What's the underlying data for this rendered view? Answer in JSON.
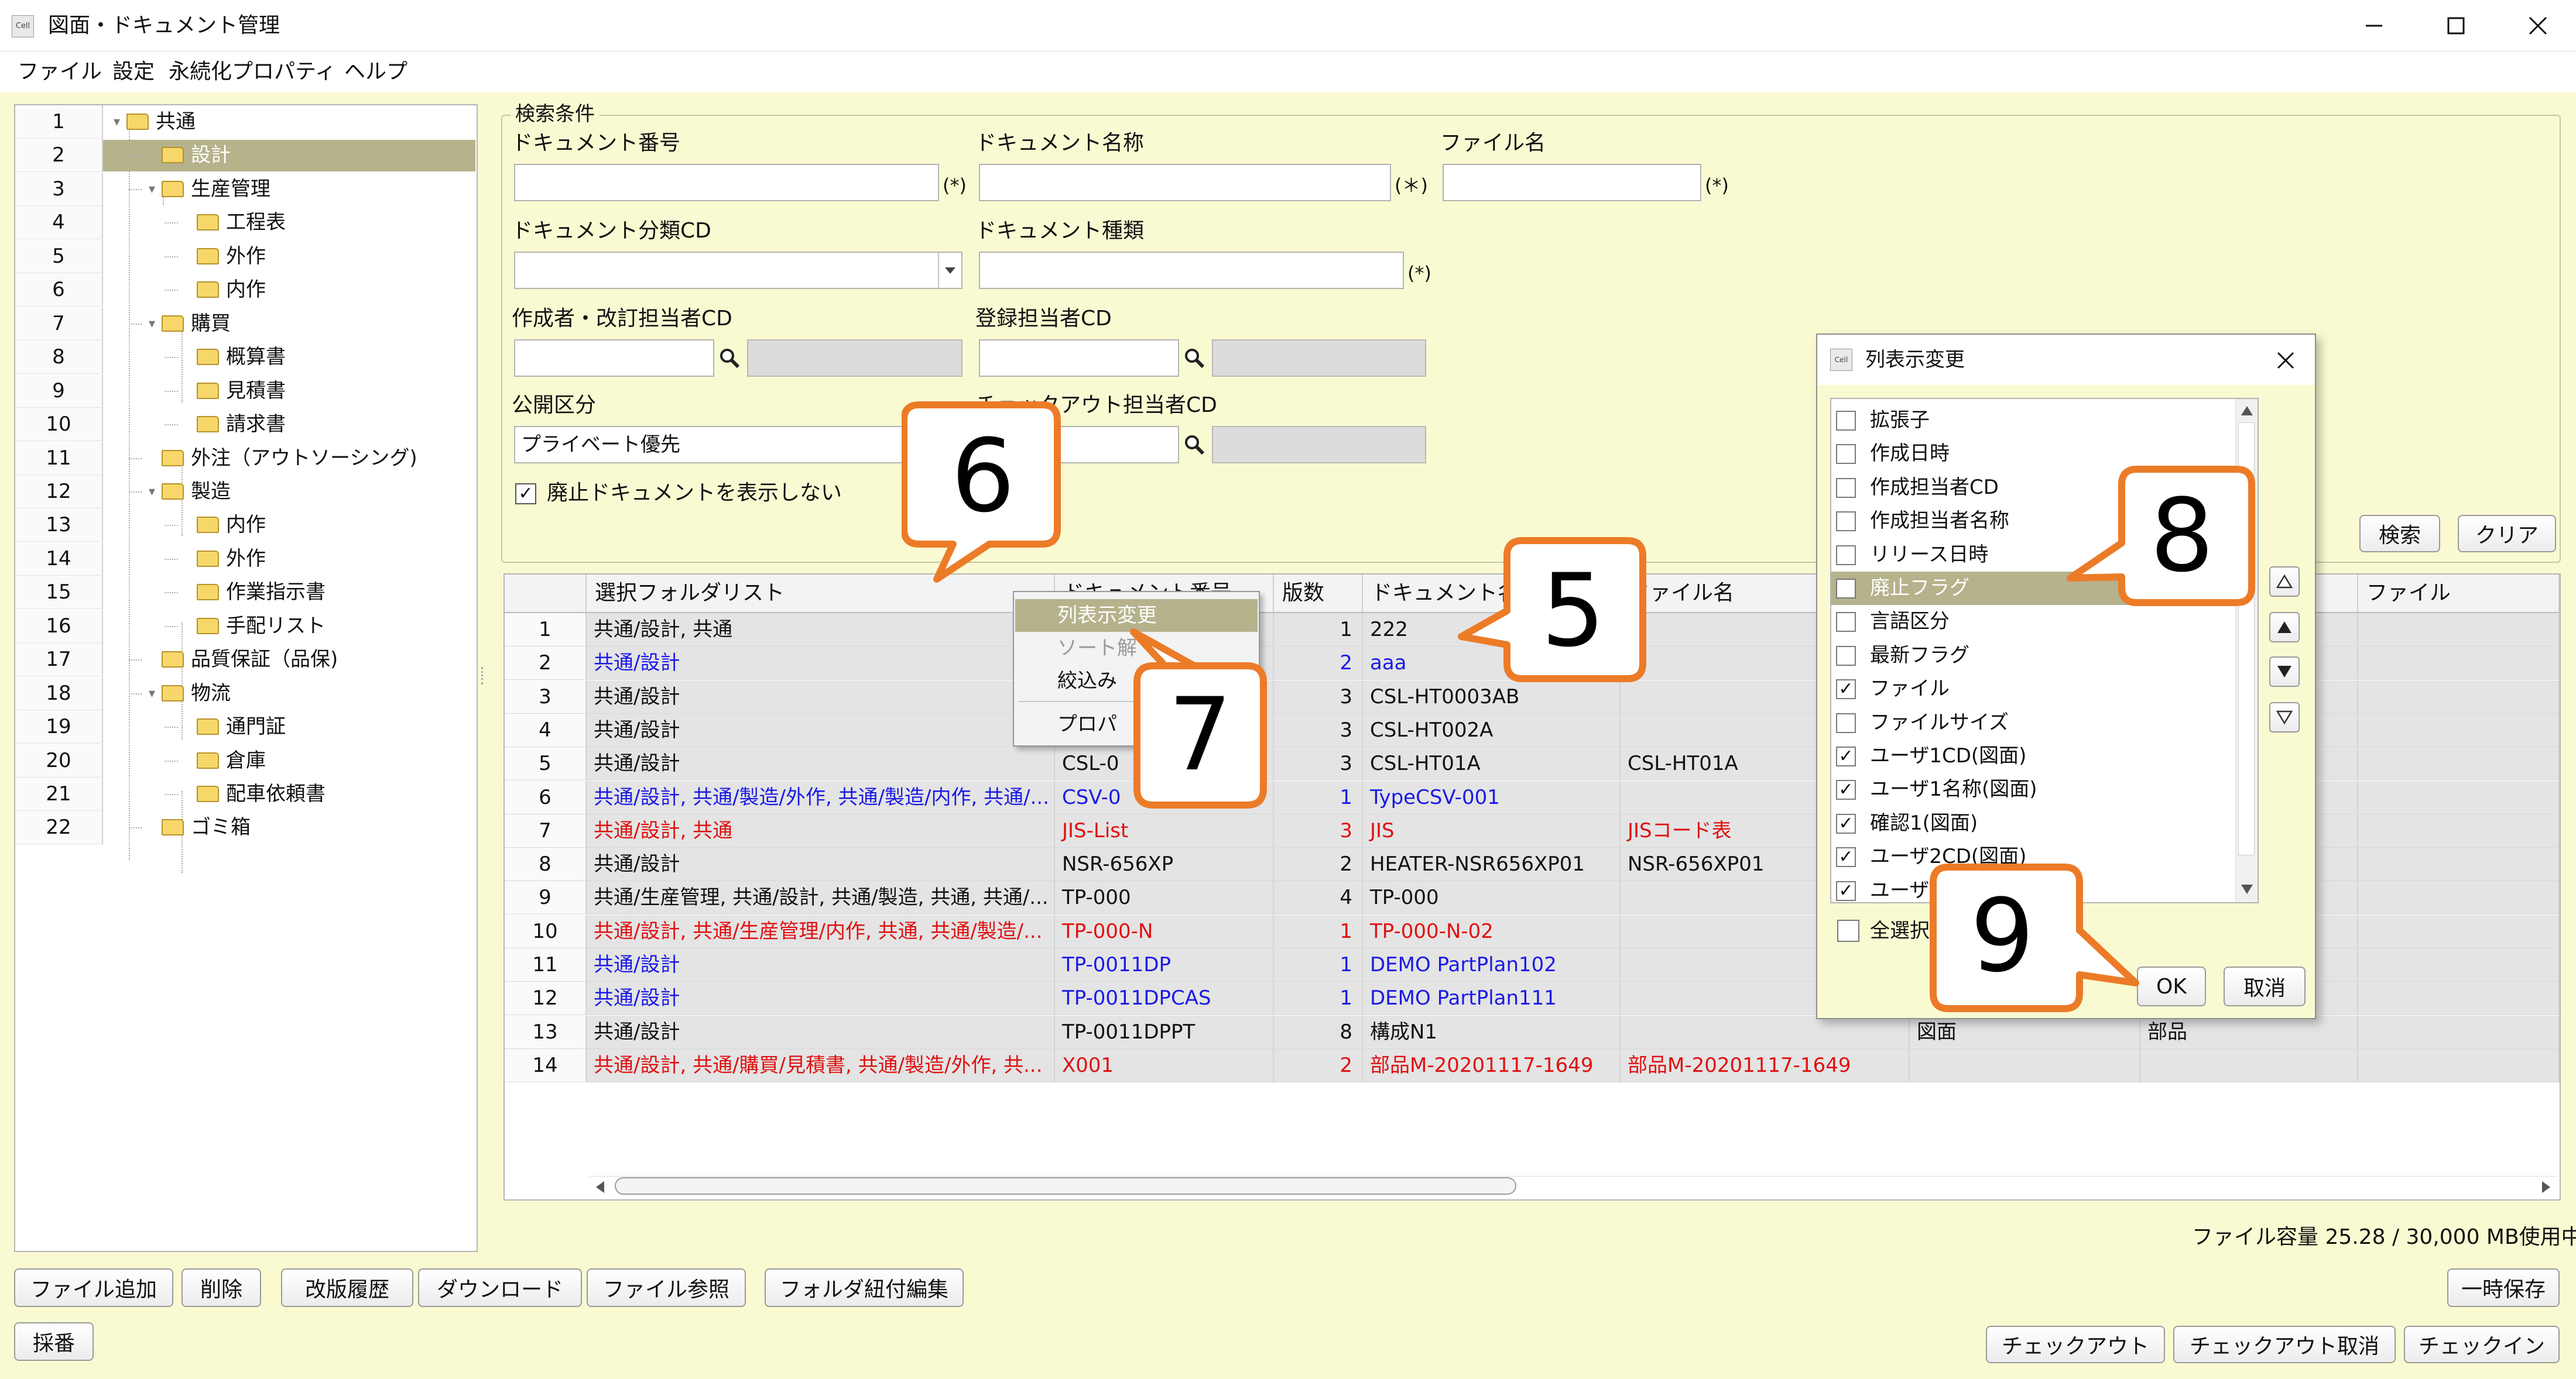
{
  "window": {
    "app_icon_text": "Cell",
    "title": "図面・ドキュメント管理"
  },
  "menu": [
    "ファイル",
    "設定",
    "永続化プロパティ",
    "ヘルプ"
  ],
  "tree": [
    {
      "num": "1",
      "label": "共通"
    },
    {
      "num": "2",
      "label": "設計"
    },
    {
      "num": "3",
      "label": "生産管理"
    },
    {
      "num": "4",
      "label": "工程表"
    },
    {
      "num": "5",
      "label": "外作"
    },
    {
      "num": "6",
      "label": "内作"
    },
    {
      "num": "7",
      "label": "購買"
    },
    {
      "num": "8",
      "label": "概算書"
    },
    {
      "num": "9",
      "label": "見積書"
    },
    {
      "num": "10",
      "label": "請求書"
    },
    {
      "num": "11",
      "label": "外注（アウトソーシング)"
    },
    {
      "num": "12",
      "label": "製造"
    },
    {
      "num": "13",
      "label": "内作"
    },
    {
      "num": "14",
      "label": "外作"
    },
    {
      "num": "15",
      "label": "作業指示書"
    },
    {
      "num": "16",
      "label": "手配リスト"
    },
    {
      "num": "17",
      "label": "品質保証（品保)"
    },
    {
      "num": "18",
      "label": "物流"
    },
    {
      "num": "19",
      "label": "通門証"
    },
    {
      "num": "20",
      "label": "倉庫"
    },
    {
      "num": "21",
      "label": "配車依頼書"
    },
    {
      "num": "22",
      "label": "ゴミ箱"
    }
  ],
  "search": {
    "legend": "検索条件",
    "doc_no_label": "ドキュメント番号",
    "doc_no_value": "",
    "doc_no_mark": "(*)",
    "doc_name_label": "ドキュメント名称",
    "doc_name_value": "",
    "doc_name_mark": "(＊)",
    "file_name_label": "ファイル名",
    "file_name_value": "",
    "file_name_mark": "(*)",
    "category_label": "ドキュメント分類CD",
    "category_value": "",
    "doc_type_label": "ドキュメント種類",
    "doc_type_value": "",
    "doc_type_mark": "(*)",
    "author_label": "作成者・改訂担当者CD",
    "author_value": "",
    "registrar_label": "登録担当者CD",
    "registrar_value": "",
    "publish_label": "公開区分",
    "publish_value": "プライベート優先",
    "checkout_label": "チェックアウト担当者CD",
    "checkout_value": "",
    "hide_obsolete_label": "廃止ドキュメントを表示しない",
    "hide_obsolete_checked": "✓",
    "search_button": "検索",
    "clear_button": "クリア"
  },
  "grid": {
    "headers": [
      "",
      "選択フォルダリスト",
      "ドキュメント番号",
      "版数",
      "ドキュメント名称",
      "ファイル名",
      "",
      "",
      "ファイル"
    ],
    "rows": [
      {
        "num": "1",
        "folders": "共通/設計, 共通",
        "doc_no": "",
        "rev": "1",
        "name": "222",
        "file": "",
        "c7": "",
        "c8": "",
        "color": "#111111"
      },
      {
        "num": "2",
        "folders": "共通/設計",
        "doc_no": "",
        "rev": "2",
        "name": "aaa",
        "file": "",
        "c7": "",
        "c8": "",
        "color": "#1a1ae6"
      },
      {
        "num": "3",
        "folders": "共通/設計",
        "doc_no": "",
        "rev": "3",
        "name": "CSL-HT0003AB",
        "file": "",
        "c7": "",
        "c8": "",
        "color": "#111111"
      },
      {
        "num": "4",
        "folders": "共通/設計",
        "doc_no": "",
        "rev": "3",
        "name": "CSL-HT002A",
        "file": "",
        "c7": "",
        "c8": "",
        "color": "#111111"
      },
      {
        "num": "5",
        "folders": "共通/設計",
        "doc_no": "CSL-0",
        "rev": "3",
        "name": "CSL-HT01A",
        "file": "CSL-HT01A",
        "c7": "",
        "c8": "",
        "color": "#111111"
      },
      {
        "num": "6",
        "folders": "共通/設計, 共通/製造/外作, 共通/製造/内作, 共通/...",
        "doc_no": "CSV-0",
        "rev": "1",
        "name": "TypeCSV-001",
        "file": "",
        "c7": "",
        "c8": "",
        "color": "#1a1ae6"
      },
      {
        "num": "7",
        "folders": "共通/設計, 共通",
        "doc_no": "JIS-List",
        "rev": "3",
        "name": "JIS",
        "file": "JISコード表",
        "c7": "",
        "c8": "",
        "color": "#e01010"
      },
      {
        "num": "8",
        "folders": "共通/設計",
        "doc_no": "NSR-656XP",
        "rev": "2",
        "name": "HEATER-NSR656XP01",
        "file": "NSR-656XP01",
        "c7": "",
        "c8": "",
        "color": "#111111"
      },
      {
        "num": "9",
        "folders": "共通/生産管理, 共通/設計, 共通/製造, 共通, 共通/...",
        "doc_no": "TP-000",
        "rev": "4",
        "name": "TP-000",
        "file": "",
        "c7": "",
        "c8": "",
        "color": "#111111"
      },
      {
        "num": "10",
        "folders": "共通/設計, 共通/生産管理/内作, 共通, 共通/製造/...",
        "doc_no": "TP-000-N",
        "rev": "1",
        "name": "TP-000-N-02",
        "file": "",
        "c7": "",
        "c8": "",
        "color": "#e01010"
      },
      {
        "num": "11",
        "folders": "共通/設計",
        "doc_no": "TP-0011DP",
        "rev": "1",
        "name": "DEMO PartPlan102",
        "file": "",
        "c7": "",
        "c8": "",
        "color": "#1a1ae6"
      },
      {
        "num": "12",
        "folders": "共通/設計",
        "doc_no": "TP-0011DPCAS",
        "rev": "1",
        "name": "DEMO PartPlan111",
        "file": "",
        "c7": "",
        "c8": "",
        "color": "#1a1ae6"
      },
      {
        "num": "13",
        "folders": "共通/設計",
        "doc_no": "TP-0011DPPT",
        "rev": "8",
        "name": "構成N1",
        "file": "",
        "c7": "図面",
        "c8": "部品",
        "color": "#111111"
      },
      {
        "num": "14",
        "folders": "共通/設計, 共通/購買/見積書, 共通/製造/外作, 共...",
        "doc_no": "X001",
        "rev": "2",
        "name": "部品M-20201117-1649",
        "file": "部品M-20201117-1649",
        "c7": "",
        "c8": "",
        "color": "#e01010"
      }
    ]
  },
  "context_menu": [
    "列表示変更",
    "ソート解",
    "絞込み",
    "プロパ"
  ],
  "dialog": {
    "title": "列表示変更",
    "app_icon_text": "Cell",
    "items": [
      {
        "label": "拡張子",
        "check": ""
      },
      {
        "label": "作成日時",
        "check": ""
      },
      {
        "label": "作成担当者CD",
        "check": ""
      },
      {
        "label": "作成担当者名称",
        "check": ""
      },
      {
        "label": "リリース日時",
        "check": ""
      },
      {
        "label": "廃止フラグ",
        "check": "✓"
      },
      {
        "label": "言語区分",
        "check": ""
      },
      {
        "label": "最新フラグ",
        "check": ""
      },
      {
        "label": "ファイル",
        "check": "✓"
      },
      {
        "label": "ファイルサイズ",
        "check": ""
      },
      {
        "label": "ユーザ1CD(図面)",
        "check": "✓"
      },
      {
        "label": "ユーザ1名称(図面)",
        "check": "✓"
      },
      {
        "label": "確認1(図面)",
        "check": "✓"
      },
      {
        "label": "ユーザ2CD(図面)",
        "check": "✓"
      },
      {
        "label": "ユーザ",
        "check": "✓"
      }
    ],
    "select_all_label": "全選択",
    "ok_button": "OK",
    "cancel_button": "取消"
  },
  "footer": {
    "capacity": "ファイル容量  25.28 / 30,000 MB使用中",
    "buttons_left": [
      "ファイル追加",
      "削除",
      "改版履歴",
      "ダウンロード",
      "ファイル参照",
      "フォルダ紐付編集"
    ],
    "temp_save": "一時保存",
    "numbering": "採番",
    "checkout": "チェックアウト",
    "checkout_cancel": "チェックアウト取消",
    "checkin": "チェックイン"
  },
  "callouts": [
    "5",
    "6",
    "7",
    "8",
    "9"
  ],
  "colors": {
    "app_background": "#fafad2",
    "selection": "#b5b28c",
    "callout_border": "#ec7b28",
    "link_blue": "#1a1ae6",
    "error_red": "#e01010"
  }
}
